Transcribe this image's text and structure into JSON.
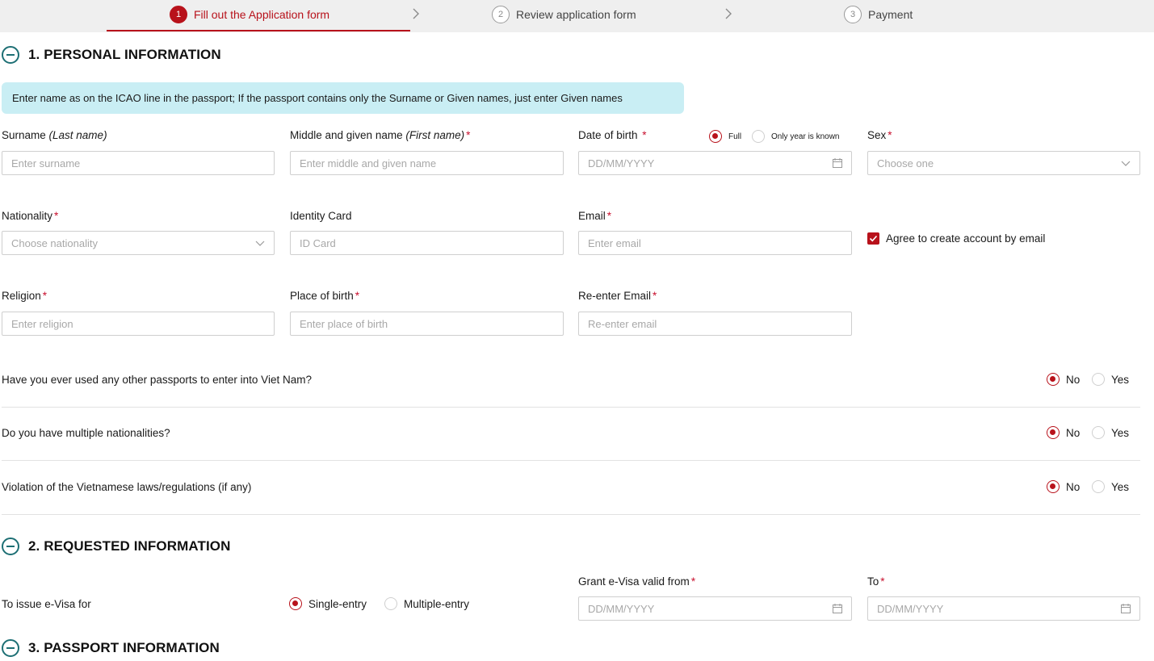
{
  "stepper": {
    "steps": [
      {
        "num": "1",
        "label": "Fill out the Application form"
      },
      {
        "num": "2",
        "label": "Review application form"
      },
      {
        "num": "3",
        "label": "Payment"
      }
    ]
  },
  "sections": {
    "personal": "1. PERSONAL INFORMATION",
    "requested": "2. REQUESTED INFORMATION",
    "passport": "3. PASSPORT INFORMATION"
  },
  "banner": "Enter name as on the ICAO line in the passport; If the passport contains only the Surname or Given names, just enter Given names",
  "fields": {
    "surname": {
      "label": "Surname ",
      "label_italic": "(Last name)",
      "placeholder": "Enter surname"
    },
    "given": {
      "label": "Middle and given name ",
      "label_italic": "(First name)",
      "req": "*",
      "placeholder": "Enter middle and given name"
    },
    "dob": {
      "label": "Date of birth ",
      "req": "*",
      "placeholder": "DD/MM/YYYY",
      "opt_full": "Full",
      "opt_year": "Only year is known"
    },
    "sex": {
      "label": "Sex",
      "req": "*",
      "placeholder": "Choose one"
    },
    "nationality": {
      "label": "Nationality",
      "req": "*",
      "placeholder": "Choose nationality"
    },
    "identity": {
      "label": "Identity Card",
      "placeholder": "ID Card"
    },
    "email": {
      "label": "Email",
      "req": "*",
      "placeholder": "Enter email"
    },
    "agree": {
      "label": "Agree to create account by email"
    },
    "religion": {
      "label": "Religion",
      "req": "*",
      "placeholder": "Enter religion"
    },
    "pob": {
      "label": "Place of birth",
      "req": "*",
      "placeholder": "Enter place of birth"
    },
    "reemail": {
      "label": "Re-enter Email",
      "req": "*",
      "placeholder": "Re-enter email"
    }
  },
  "questions": [
    {
      "text": "Have you ever used any other passports to enter into Viet Nam?",
      "no": "No",
      "yes": "Yes"
    },
    {
      "text": "Do you have multiple nationalities?",
      "no": "No",
      "yes": "Yes"
    },
    {
      "text": "Violation of the Vietnamese laws/regulations (if any)",
      "no": "No",
      "yes": "Yes"
    }
  ],
  "requested": {
    "issue_label": "To issue e-Visa for",
    "single": "Single-entry",
    "multiple": "Multiple-entry",
    "valid_from_label": "Grant e-Visa valid from",
    "valid_from_req": "*",
    "valid_from_placeholder": "DD/MM/YYYY",
    "to_label": "To",
    "to_req": "*",
    "to_placeholder": "DD/MM/YYYY"
  },
  "colors": {
    "accent": "#b8121b",
    "banner": "#c9eef4",
    "section_icon": "#1d6f74"
  }
}
